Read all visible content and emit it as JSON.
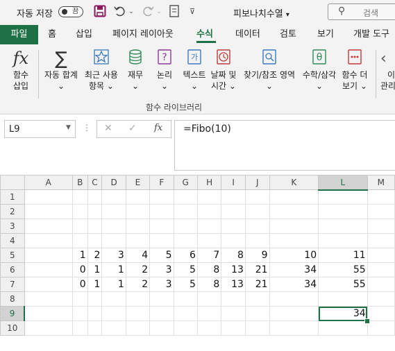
{
  "titlebar": {
    "autosave_label": "자동 저장",
    "toggle_state": "끔",
    "doc_title": "피보나치수열",
    "doc_caret": "▾",
    "search_placeholder": "검색"
  },
  "tabs": [
    "파일",
    "홈",
    "삽입",
    "페이지 레이아웃",
    "수식",
    "데이터",
    "검토",
    "보기",
    "개발 도구"
  ],
  "active_tab": "수식",
  "ribbon": {
    "insert_fn": {
      "line1": "함수",
      "line2": "삽입"
    },
    "buttons": [
      {
        "line1": "자동 합계",
        "line2": "⌄"
      },
      {
        "line1": "최근 사용",
        "line2": "항목 ⌄"
      },
      {
        "line1": "재무",
        "line2": "⌄"
      },
      {
        "line1": "논리",
        "line2": "⌄"
      },
      {
        "line1": "텍스트",
        "line2": "⌄"
      },
      {
        "line1": "날짜 및",
        "line2": "시간 ⌄"
      },
      {
        "line1": "찾기/참조 영역",
        "line2": "⌄"
      },
      {
        "line1": "수학/삼각",
        "line2": "⌄"
      },
      {
        "line1": "함수 더",
        "line2": "보기 ⌄"
      },
      {
        "line1": "이",
        "line2": "관리"
      }
    ],
    "group_label": "함수 라이브러리"
  },
  "formula_bar": {
    "name_box": "L9",
    "formula": "=Fibo(10)",
    "fx_label": "fx"
  },
  "sheet": {
    "columns": [
      "A",
      "B",
      "C",
      "D",
      "E",
      "F",
      "G",
      "H",
      "I",
      "J",
      "K",
      "L",
      "M"
    ],
    "selected_col": "L",
    "selected_row": 9,
    "rows": [
      {
        "n": "1",
        "cells": [
          "",
          "",
          "",
          "",
          "",
          "",
          "",
          "",
          "",
          "",
          "",
          "",
          ""
        ]
      },
      {
        "n": "2",
        "cells": [
          "",
          "",
          "",
          "",
          "",
          "",
          "",
          "",
          "",
          "",
          "",
          "",
          ""
        ]
      },
      {
        "n": "3",
        "cells": [
          "",
          "",
          "",
          "",
          "",
          "",
          "",
          "",
          "",
          "",
          "",
          "",
          ""
        ]
      },
      {
        "n": "4",
        "cells": [
          "",
          "",
          "",
          "",
          "",
          "",
          "",
          "",
          "",
          "",
          "",
          "",
          ""
        ]
      },
      {
        "n": "5",
        "cells": [
          "",
          "1",
          "2",
          "3",
          "4",
          "5",
          "6",
          "7",
          "8",
          "9",
          "10",
          "11",
          ""
        ]
      },
      {
        "n": "6",
        "cells": [
          "",
          "0",
          "1",
          "1",
          "2",
          "3",
          "5",
          "8",
          "13",
          "21",
          "34",
          "55",
          ""
        ]
      },
      {
        "n": "7",
        "cells": [
          "",
          "0",
          "1",
          "1",
          "2",
          "3",
          "5",
          "8",
          "13",
          "21",
          "34",
          "55",
          ""
        ]
      },
      {
        "n": "8",
        "cells": [
          "",
          "",
          "",
          "",
          "",
          "",
          "",
          "",
          "",
          "",
          "",
          "",
          ""
        ]
      },
      {
        "n": "9",
        "cells": [
          "",
          "",
          "",
          "",
          "",
          "",
          "",
          "",
          "",
          "",
          "",
          "34",
          ""
        ]
      },
      {
        "n": "10",
        "cells": [
          "",
          "",
          "",
          "",
          "",
          "",
          "",
          "",
          "",
          "",
          "",
          "",
          ""
        ]
      }
    ]
  },
  "colors": {
    "accent": "#1e7145",
    "ribbon_bg": "#f3f3f3"
  }
}
